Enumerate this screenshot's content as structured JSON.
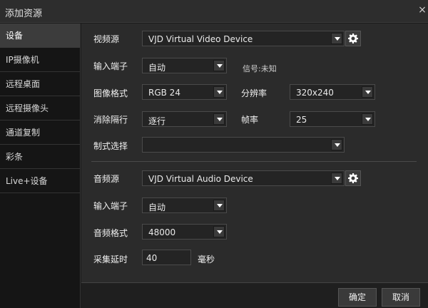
{
  "window": {
    "title": "添加资源",
    "close_glyph": "×"
  },
  "sidebar": {
    "items": [
      {
        "label": "设备",
        "active": true
      },
      {
        "label": "IP摄像机"
      },
      {
        "label": "远程桌面"
      },
      {
        "label": "远程摄像头"
      },
      {
        "label": "通道复制"
      },
      {
        "label": "彩条"
      },
      {
        "label": "Live+设备"
      }
    ]
  },
  "video": {
    "source_label": "视频源",
    "source_value": "VJD Virtual Video Device",
    "input_label": "输入端子",
    "input_value": "自动",
    "signal_text": "信号:未知",
    "format_label": "图像格式",
    "format_value": "RGB 24",
    "resolution_label": "分辨率",
    "resolution_value": "320x240",
    "deinterlace_label": "消除隔行",
    "deinterlace_value": "逐行",
    "framerate_label": "帧率",
    "framerate_value": "25",
    "standard_label": "制式选择",
    "standard_value": ""
  },
  "audio": {
    "source_label": "音频源",
    "source_value": "VJD Virtual Audio Device",
    "input_label": "输入端子",
    "input_value": "自动",
    "format_label": "音频格式",
    "format_value": "48000",
    "delay_label": "采集延时",
    "delay_value": "40",
    "delay_unit": "毫秒"
  },
  "buttons": {
    "ok": "确定",
    "cancel": "取消"
  },
  "icons": {
    "settings": "gear-icon",
    "dropdown": "chevron-down-icon"
  }
}
